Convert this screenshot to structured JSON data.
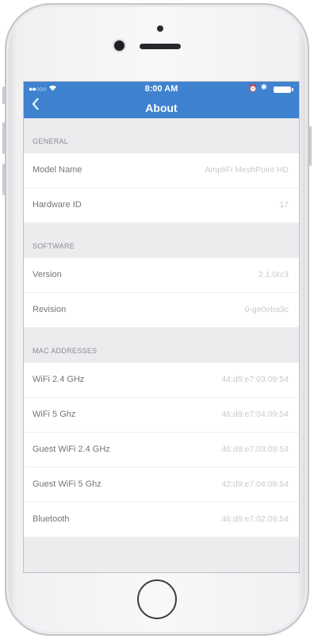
{
  "status_bar": {
    "time": "8:00 AM"
  },
  "navbar": {
    "title": "About",
    "back_icon": "chevron-left-icon"
  },
  "sections": [
    {
      "header": "GENERAL",
      "rows": [
        {
          "label": "Model Name",
          "value": "AmpliFi MeshPoint HD"
        },
        {
          "label": "Hardware ID",
          "value": "17"
        }
      ]
    },
    {
      "header": "SOFTWARE",
      "rows": [
        {
          "label": "Version",
          "value": "2.1.0rc3"
        },
        {
          "label": "Revision",
          "value": "0-ge0eba3c"
        }
      ]
    },
    {
      "header": "MAC ADDRESSES",
      "rows": [
        {
          "label": "WiFi 2.4 GHz",
          "value": "44:d9:e7:03:09:54"
        },
        {
          "label": "WiFi 5 Ghz",
          "value": "46:d9:e7:04:09:54"
        },
        {
          "label": "Guest WiFi 2.4 GHz",
          "value": "46:d9:e7:03:09:54"
        },
        {
          "label": "Guest WiFi 5 Ghz",
          "value": "42:d9:e7:04:09:54"
        },
        {
          "label": "Bluetooth",
          "value": "46:d9:e7:02:09:54"
        }
      ]
    }
  ],
  "colors": {
    "navbar": "#3f82cf",
    "background": "#ececee",
    "row": "#ffffff"
  }
}
